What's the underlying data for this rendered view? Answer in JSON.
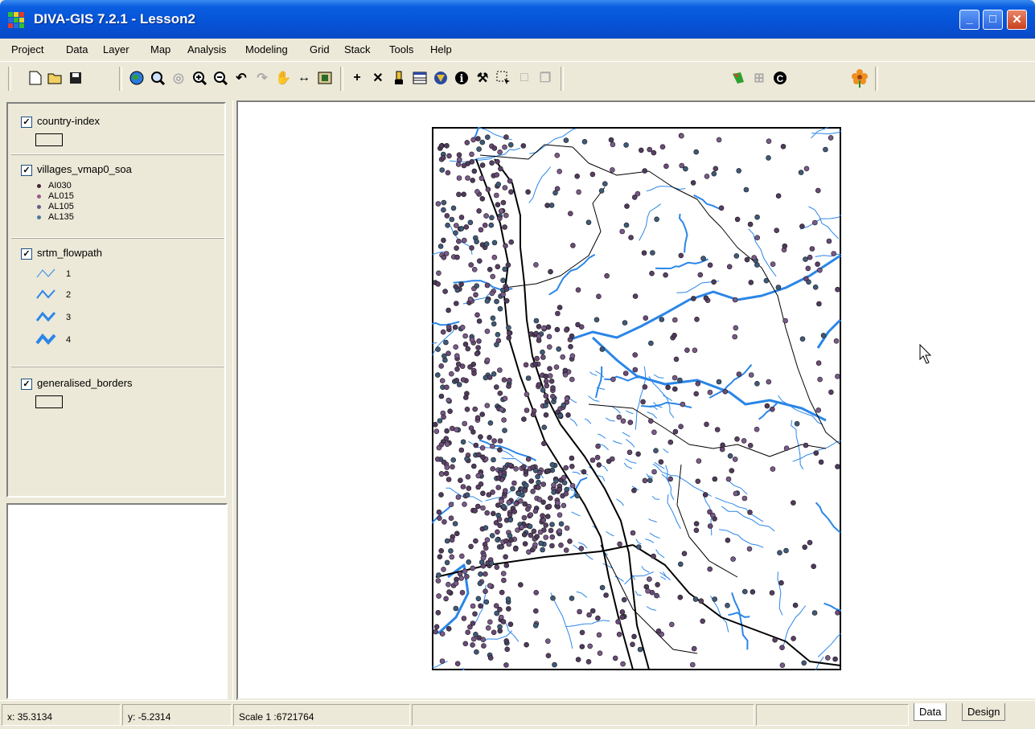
{
  "window": {
    "title": "DIVA-GIS 7.2.1 - Lesson2",
    "minimize_glyph": "_",
    "maximize_glyph": "□",
    "close_glyph": "✕"
  },
  "menu": [
    "Project",
    "Data",
    "Layer",
    "Map",
    "Analysis",
    "Modeling",
    "Grid",
    "Stack",
    "Tools",
    "Help"
  ],
  "toolbar": {
    "icons": [
      "new-icon",
      "open-icon",
      "save-icon",
      "full-extent-icon",
      "zoom-to-layer-icon",
      "zoom-selected-icon",
      "zoom-in-icon",
      "zoom-out-icon",
      "undo-zoom-icon",
      "redo-zoom-icon",
      "pan-icon",
      "measure-icon",
      "export-icon",
      "add-point-icon",
      "delete-icon",
      "select-feature-icon",
      "attribute-table-icon",
      "query-icon",
      "info-icon",
      "tools-icon",
      "select-rect-icon",
      "clear-selection-icon",
      "copy-icon",
      "map-design-icon",
      "grid-icon",
      "c-icon",
      "flower-icon"
    ],
    "glyphs": {
      "add": "+",
      "delete": "✕",
      "info": "i",
      "c": "C",
      "undo": "↶",
      "redo": "↷",
      "pan": "✋",
      "measure": "↔"
    }
  },
  "legend": {
    "layers": [
      {
        "name": "country-index",
        "checked": true,
        "type": "polygon"
      },
      {
        "name": "villages_vmap0_soa",
        "checked": true,
        "type": "point",
        "classes": [
          {
            "label": "AI030",
            "color": "#4a1f3a"
          },
          {
            "label": "AL015",
            "color": "#9a5a8a"
          },
          {
            "label": "AL105",
            "color": "#6a5a8a"
          },
          {
            "label": "AL135",
            "color": "#4a7a9a"
          }
        ]
      },
      {
        "name": "srtm_flowpath",
        "checked": true,
        "type": "line",
        "classes": [
          {
            "label": "1"
          },
          {
            "label": "2"
          },
          {
            "label": "3"
          },
          {
            "label": "4"
          }
        ]
      },
      {
        "name": "generalised_borders",
        "checked": true,
        "type": "polygon"
      }
    ]
  },
  "colors": {
    "river": "#2a86e8",
    "village": "#5a3f66",
    "border": "#000000",
    "titlebar": "#0552d6"
  },
  "status": {
    "x": "x: 35.3134",
    "y": "y: -5.2314",
    "scale": "Scale 1 :6721764"
  },
  "tabs": [
    "Data",
    "Design"
  ]
}
